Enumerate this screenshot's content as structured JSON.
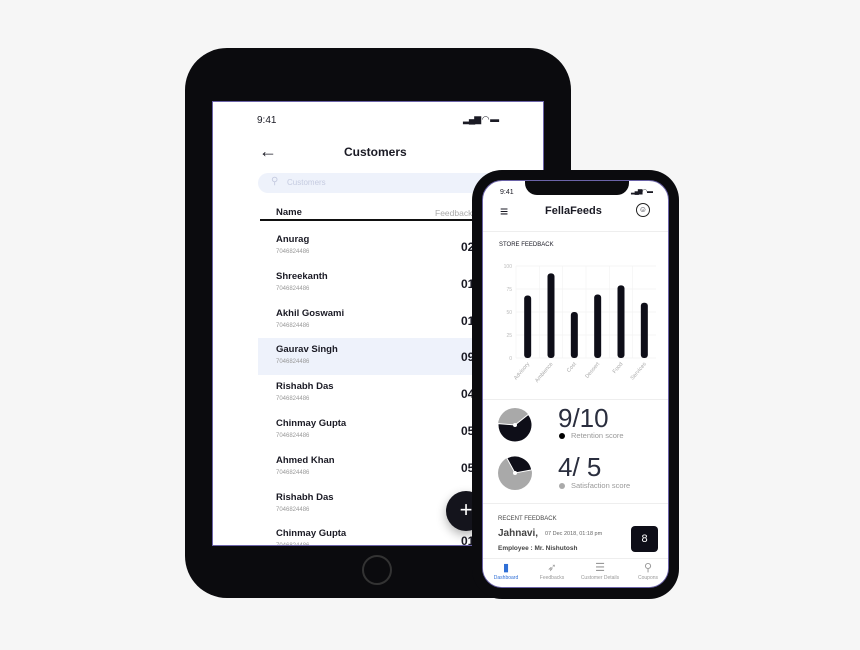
{
  "tablet": {
    "time": "9:41",
    "title": "Customers",
    "search_placeholder": "Customers",
    "col_name": "Name",
    "col_feedback": "Feedback",
    "rows": [
      {
        "name": "Anurag",
        "phone": "7046824486",
        "value": "02"
      },
      {
        "name": "Shreekanth",
        "phone": "7046824486",
        "value": "01"
      },
      {
        "name": "Akhil Goswami",
        "phone": "7046824486",
        "value": "01"
      },
      {
        "name": "Gaurav Singh",
        "phone": "7046824486",
        "value": "09"
      },
      {
        "name": "Rishabh Das",
        "phone": "7046824486",
        "value": "04"
      },
      {
        "name": "Chinmay Gupta",
        "phone": "7046824486",
        "value": "05"
      },
      {
        "name": "Ahmed Khan",
        "phone": "7046824486",
        "value": "05"
      },
      {
        "name": "Rishabh Das",
        "phone": "7046824486",
        "value": ""
      },
      {
        "name": "Chinmay Gupta",
        "phone": "7046824486",
        "value": "01"
      }
    ],
    "fab": "+"
  },
  "phone": {
    "time": "9:41",
    "app_title": "FellaFeeds",
    "store_feedback": "STORE FEEDBACK",
    "retention": {
      "value": "9/10",
      "label": "Retention score",
      "fraction": 0.9
    },
    "satisfaction": {
      "value": "4/ 5",
      "label": "Satisfaction score",
      "fraction": 0.3
    },
    "recent": {
      "title": "RECENT FEEDBACK",
      "name": "Jahnavi,",
      "date": "07 Dec 2018, 01:18 pm",
      "employee": "Employee :  Mr. Nishutosh",
      "score": "8"
    },
    "tabs": [
      {
        "label": "Dashboard",
        "icon": "dashboard-icon",
        "active": true
      },
      {
        "label": "Feedbacks",
        "icon": "rocket-icon"
      },
      {
        "label": "Customer Details",
        "icon": "layers-icon"
      },
      {
        "label": "Coupons",
        "icon": "search-icon"
      }
    ],
    "accent": "#2f6fd6"
  },
  "chart_data": {
    "type": "bar",
    "title": "STORE FEEDBACK",
    "categories": [
      "Advisory",
      "Ambience",
      "Cost",
      "Dessert",
      "Food",
      "Services"
    ],
    "values": [
      68,
      92,
      50,
      69,
      79,
      60
    ],
    "ylim": [
      0,
      100
    ],
    "yticks": [
      0,
      25,
      50,
      75,
      100
    ],
    "grid": true,
    "color": "#0e0e18"
  }
}
